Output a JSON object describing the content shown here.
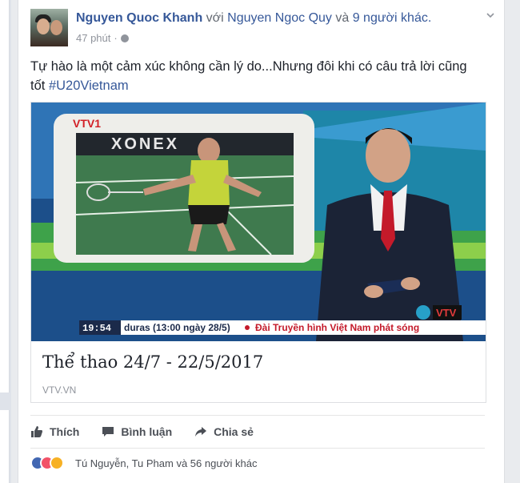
{
  "post": {
    "author": "Nguyen Quoc Khanh",
    "with_word": " với ",
    "tagged_person": "Nguyen Ngoc Quy",
    "and_word": " và ",
    "others": "9 người khác.",
    "timestamp": "47 phút",
    "separator": "·",
    "text_line1": "Tự hào là một cảm xúc không cần lý do...Nhưng đôi khi có câu trả lời cũng",
    "text_line2": "tốt ",
    "hashtag": "#U20Vietnam"
  },
  "link_card": {
    "title": "Thể thao 24/7 - 22/5/2017",
    "source": "VTV.VN",
    "video": {
      "channel_logo": "VTV1",
      "sponsor_text": "XONEX",
      "clock": "19:54",
      "ticker": "duras (13:00 ngày 28/5)",
      "ticker2": "Đài Truyền hình Việt Nam phát sóng",
      "corner_logo": "VTV"
    }
  },
  "actions": {
    "like": "Thích",
    "comment": "Bình luận",
    "share": "Chia sẻ"
  },
  "reactions": {
    "summary": "Tú Nguyễn, Tu Pham và 56 người khác"
  },
  "colors": {
    "link_blue": "#365899",
    "text": "#1d2129",
    "muted": "#90949c"
  }
}
